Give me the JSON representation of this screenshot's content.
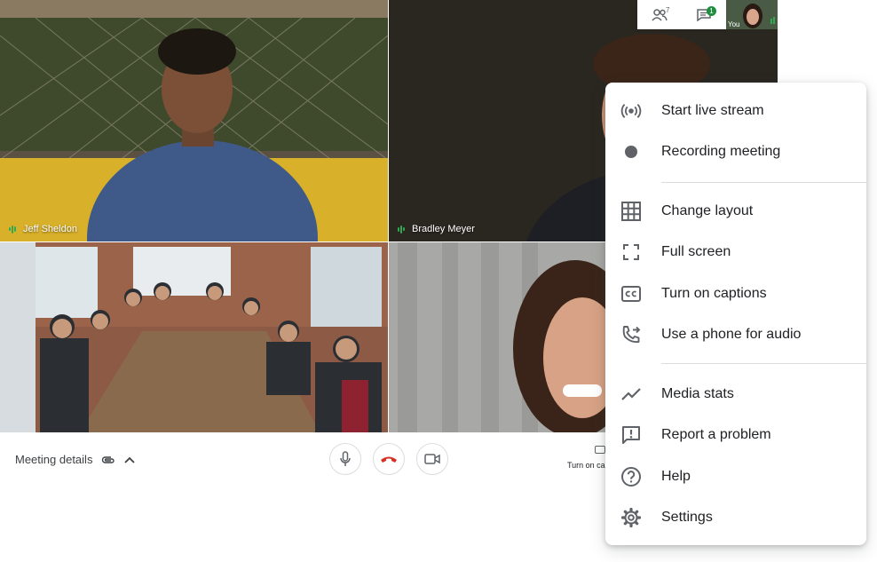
{
  "participants": [
    {
      "name": "Jeff Sheldon"
    },
    {
      "name": "Bradley Meyer"
    },
    {
      "name": ""
    },
    {
      "name": ""
    }
  ],
  "topbar": {
    "people_count": "7",
    "chat_badge": "1",
    "self_label": "You"
  },
  "bottom_bar": {
    "meeting_details_label": "Meeting details",
    "captions_peek_label": "Turn on ca"
  },
  "menu": {
    "items": [
      {
        "label": "Start live stream",
        "icon": "live-stream-icon"
      },
      {
        "label": "Recording meeting",
        "icon": "record-dot-icon"
      },
      {
        "label": "Change layout",
        "icon": "grid-layout-icon"
      },
      {
        "label": "Full screen",
        "icon": "fullscreen-icon"
      },
      {
        "label": "Turn on captions",
        "icon": "closed-captions-icon"
      },
      {
        "label": "Use a phone for audio",
        "icon": "phone-forward-icon"
      },
      {
        "label": "Media stats",
        "icon": "trending-line-icon"
      },
      {
        "label": "Report a problem",
        "icon": "feedback-icon"
      },
      {
        "label": "Help",
        "icon": "help-icon"
      },
      {
        "label": "Settings",
        "icon": "settings-gear-icon"
      }
    ]
  },
  "colors": {
    "speaking_indicator": "#34a853",
    "hangup_red": "#d93025",
    "icon_gray": "#5f6368"
  }
}
